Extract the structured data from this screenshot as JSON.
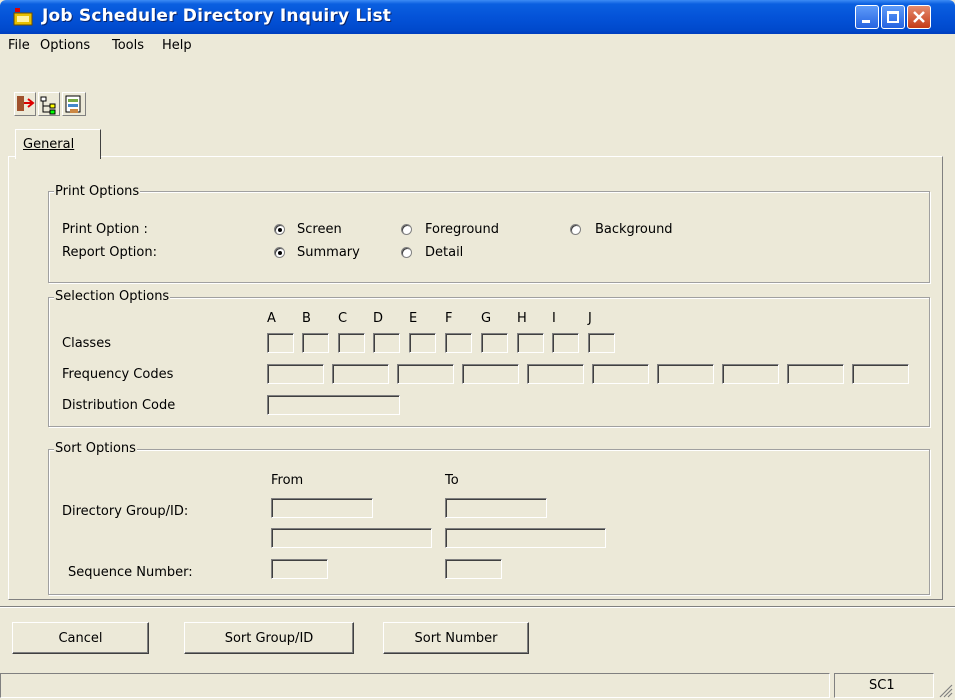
{
  "window": {
    "title": "Job Scheduler Directory Inquiry List"
  },
  "menu": [
    "File",
    "Options",
    "Tools",
    "Help"
  ],
  "toolbar": {
    "buttons": [
      "exit-icon",
      "tree-icon",
      "scheduler-icon"
    ]
  },
  "tabs": [
    {
      "label": "General",
      "selected": true
    }
  ],
  "print_options": {
    "legend": "Print Options",
    "print_option_label": "Print Option :",
    "print_choices": [
      "Screen",
      "Foreground",
      "Background"
    ],
    "print_selected": "Screen",
    "report_option_label": "Report Option:",
    "report_choices": [
      "Summary",
      "Detail"
    ],
    "report_selected": "Summary"
  },
  "selection_options": {
    "legend": "Selection Options",
    "class_letters": [
      "A",
      "B",
      "C",
      "D",
      "E",
      "F",
      "G",
      "H",
      "I",
      "J"
    ],
    "classes_label": "Classes",
    "classes_values": [
      "",
      "",
      "",
      "",
      "",
      "",
      "",
      "",
      "",
      ""
    ],
    "frequency_label": "Frequency Codes",
    "frequency_values": [
      "",
      "",
      "",
      "",
      "",
      "",
      "",
      "",
      "",
      ""
    ],
    "distribution_label": "Distribution Code",
    "distribution_value": ""
  },
  "sort_options": {
    "legend": "Sort Options",
    "from_label": "From",
    "to_label": "To",
    "directory_label": "Directory Group/ID:",
    "directory_from_group": "",
    "directory_from_id": "",
    "directory_to_group": "",
    "directory_to_id": "",
    "sequence_label": "Sequence Number:",
    "sequence_from": "",
    "sequence_to": ""
  },
  "buttons": {
    "cancel": "Cancel",
    "sort_group": "Sort Group/ID",
    "sort_number": "Sort Number"
  },
  "status": {
    "panel": "SC1"
  }
}
